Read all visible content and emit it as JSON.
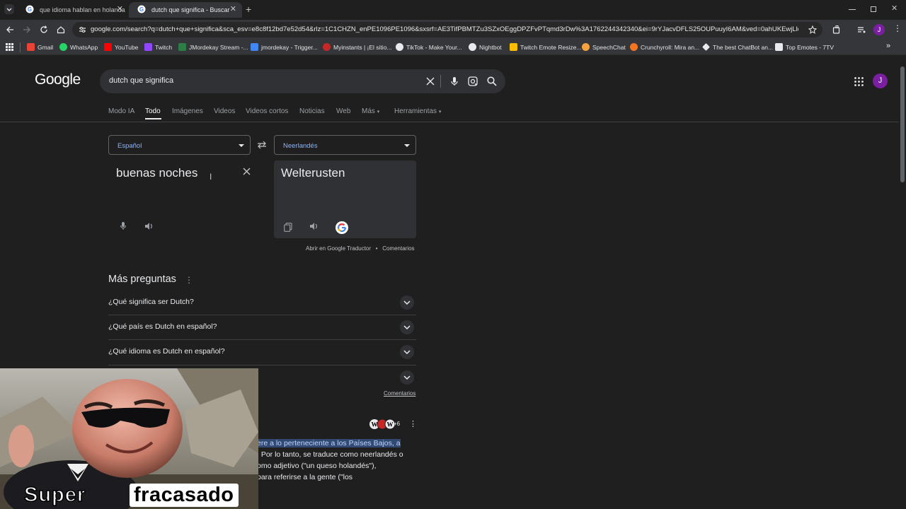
{
  "browser": {
    "tabs": [
      {
        "title": "que idioma hablan en holanda",
        "active": false
      },
      {
        "title": "dutch que significa - Buscar",
        "active": true
      }
    ],
    "url": "google.com/search?q=dutch+que+significa&sca_esv=e8c8f12bd7e52d54&rlz=1C1CHZN_enPE1096PE1096&sxsrf=AE3TifPBMTZu3SZxOEggDPZFvPTqmd3rDw%3A1762244342340&ei=9rYJacvDFLS25OUPuuyI6AM&ved=0ahUKEwjLlqHgh9iQAx...",
    "bookmarks": [
      {
        "label": "Gmail",
        "color": "#ea4335"
      },
      {
        "label": "WhatsApp",
        "color": "#25d366"
      },
      {
        "label": "YouTube",
        "color": "#ff0000"
      },
      {
        "label": "Twitch",
        "color": "#9146ff"
      },
      {
        "label": "JMordekay Stream -...",
        "color": "#2d7d46"
      },
      {
        "label": "jmordekay - Trigger...",
        "color": "#4285f4"
      },
      {
        "label": "Myinstants | ¡El sitio...",
        "color": "#c62828"
      },
      {
        "label": "TikTok - Make Your...",
        "color": "#e8eaed"
      },
      {
        "label": "Nightbot",
        "color": "#e8eaed"
      },
      {
        "label": "Twitch Emote Resize...",
        "color": "#fbbc04"
      },
      {
        "label": "SpeechChat",
        "color": "#f4a340"
      },
      {
        "label": "Crunchyroll: Mira an...",
        "color": "#f47521"
      },
      {
        "label": "The best ChatBot an...",
        "color": "#e8eaed"
      },
      {
        "label": "Top Emotes - 7TV",
        "color": "#e8eaed"
      }
    ]
  },
  "google": {
    "logo": "Google",
    "query": "dutch que significa",
    "avatar_letter": "J",
    "nav": [
      "Modo IA",
      "Todo",
      "Imágenes",
      "Videos",
      "Videos cortos",
      "Noticias",
      "Web",
      "Más",
      "Herramientas"
    ]
  },
  "translator": {
    "source_lang": "Español",
    "target_lang": "Neerlandés",
    "source_text": "buenas noches",
    "target_text": "Welterusten",
    "open_link": "Abrir en Google Traductor",
    "bullet": "•",
    "feedback": "Comentarios"
  },
  "paa": {
    "title": "Más preguntas",
    "questions": [
      "¿Qué significa ser Dutch?",
      "¿Qué país es Dutch en español?",
      "¿Qué idioma es Dutch en español?"
    ],
    "feedback": "Comentarios"
  },
  "snippet": {
    "source_count": "+6",
    "highlight": "ere a lo perteneciente a los Países Bajos, a",
    "line2": ". Por lo tanto, se traduce como neerlandés o",
    "line3": "omo adjetivo (\"un queso holandés\"),",
    "line4": "para referirse a la gente (\"los"
  },
  "overlay": {
    "caption_word1": "Super",
    "caption_word2": "fracasado"
  },
  "colors": {
    "accent_blue": "#8ab4f8",
    "avatar_purple": "#7b1fa2",
    "highlight_bg": "#314a74"
  }
}
